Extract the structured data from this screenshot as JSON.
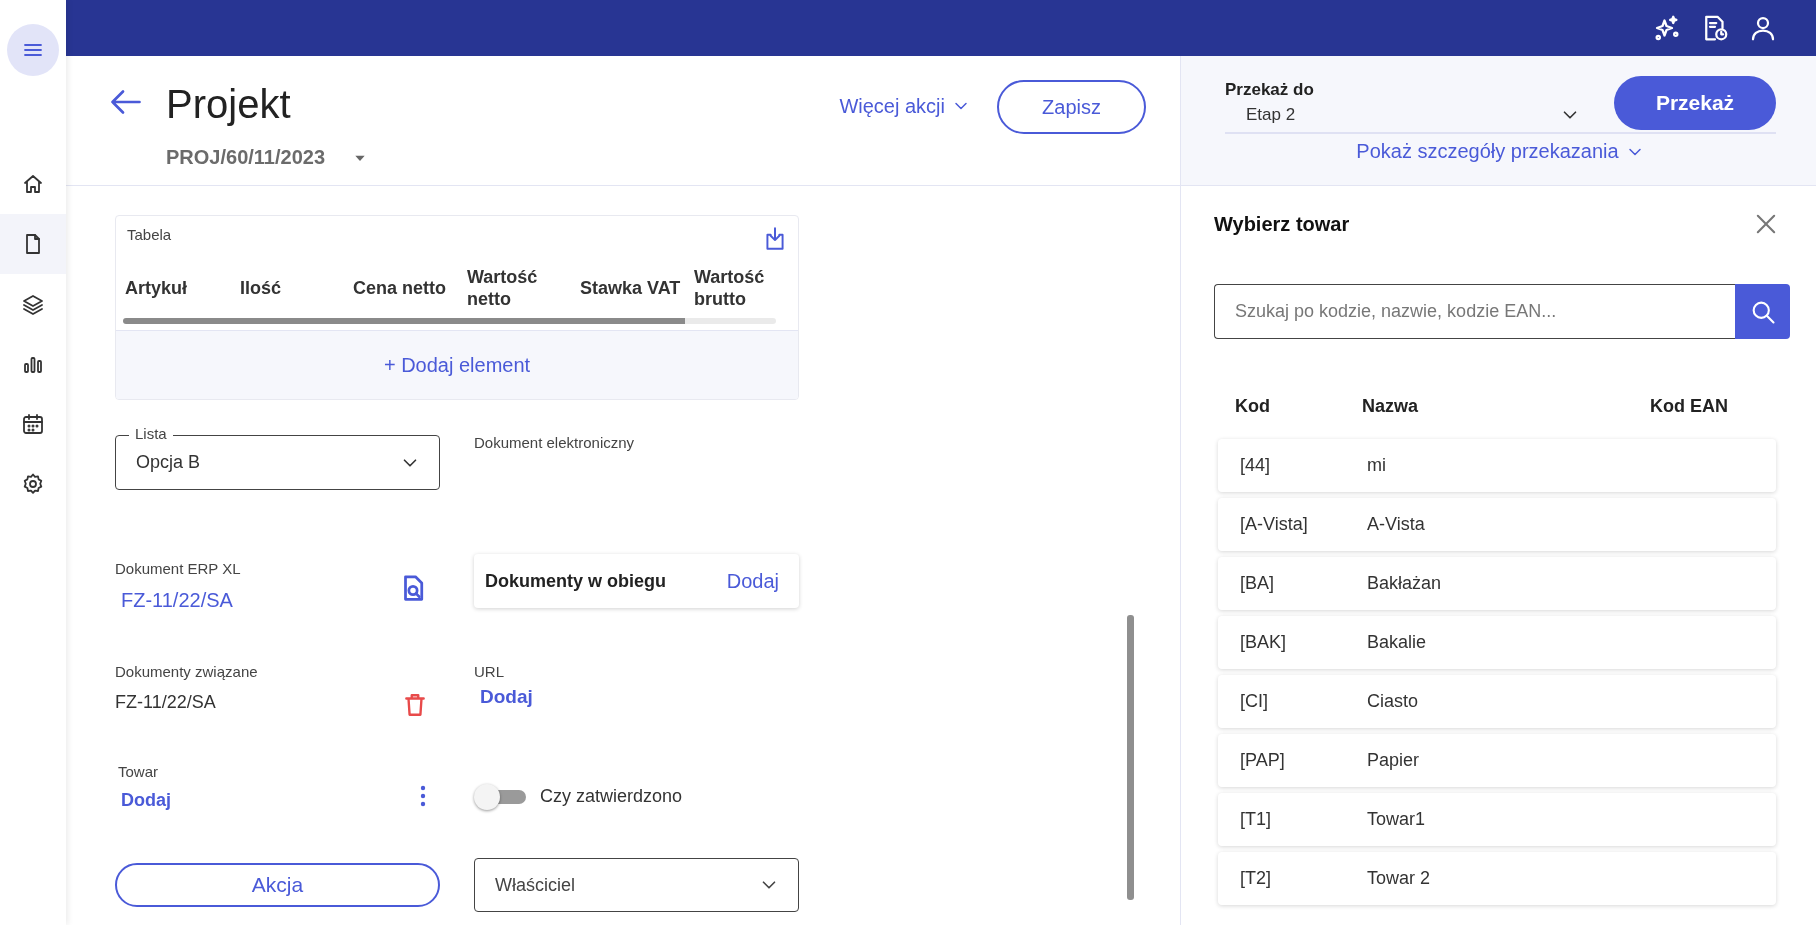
{
  "sidebar": {
    "items": [
      {
        "kind": "menu",
        "selected": true
      },
      {
        "kind": "home",
        "selected": false
      },
      {
        "kind": "document",
        "selected": true
      },
      {
        "kind": "layers",
        "selected": false
      },
      {
        "kind": "chart",
        "selected": false
      },
      {
        "kind": "calendar",
        "selected": false
      },
      {
        "kind": "settings",
        "selected": false
      }
    ]
  },
  "header": {
    "title": "Projekt",
    "number": "PROJ/60/11/2023",
    "more_actions": "Więcej akcji",
    "save": "Zapisz"
  },
  "form": {
    "table": {
      "label": "Tabela",
      "columns": [
        "Artykuł",
        "Ilość",
        "Cena netto",
        "Wartość netto",
        "Stawka VAT",
        "Wartość brutto"
      ],
      "add": "+ Dodaj element"
    },
    "list_field": {
      "label": "Lista",
      "value": "Opcja B"
    },
    "electronic_doc": {
      "label": "Dokument elektroniczny"
    },
    "erp_doc": {
      "label": "Dokument ERP XL",
      "value": "FZ-11/22/SA"
    },
    "docs_in_circulation": {
      "label": "Dokumenty w obiegu",
      "action": "Dodaj"
    },
    "related_docs": {
      "label": "Dokumenty związane",
      "value": "FZ-11/22/SA"
    },
    "url": {
      "label": "URL",
      "action": "Dodaj"
    },
    "item": {
      "label": "Towar",
      "action": "Dodaj"
    },
    "approved": {
      "label": "Czy zatwierdzono",
      "on": false
    },
    "action_button": "Akcja",
    "owner": {
      "placeholder": "Właściciel"
    }
  },
  "transfer": {
    "label": "Przekaż do",
    "value": "Etap 2",
    "button": "Przekaż",
    "details_link": "Pokaż szczegóły przekazania"
  },
  "picker": {
    "title": "Wybierz towar",
    "search": {
      "placeholder": "Szukaj po kodzie, nazwie, kodzie EAN..."
    },
    "columns": [
      "Kod",
      "Nazwa",
      "Kod EAN"
    ],
    "rows": [
      {
        "code": "[44]",
        "name": "mi"
      },
      {
        "code": "[A-Vista]",
        "name": "A-Vista"
      },
      {
        "code": "[BA]",
        "name": "Bakłażan"
      },
      {
        "code": "[BAK]",
        "name": "Bakalie"
      },
      {
        "code": "[CI]",
        "name": "Ciasto"
      },
      {
        "code": "[PAP]",
        "name": "Papier"
      },
      {
        "code": "[T1]",
        "name": "Towar1"
      },
      {
        "code": "[T2]",
        "name": "Towar 2"
      }
    ]
  }
}
